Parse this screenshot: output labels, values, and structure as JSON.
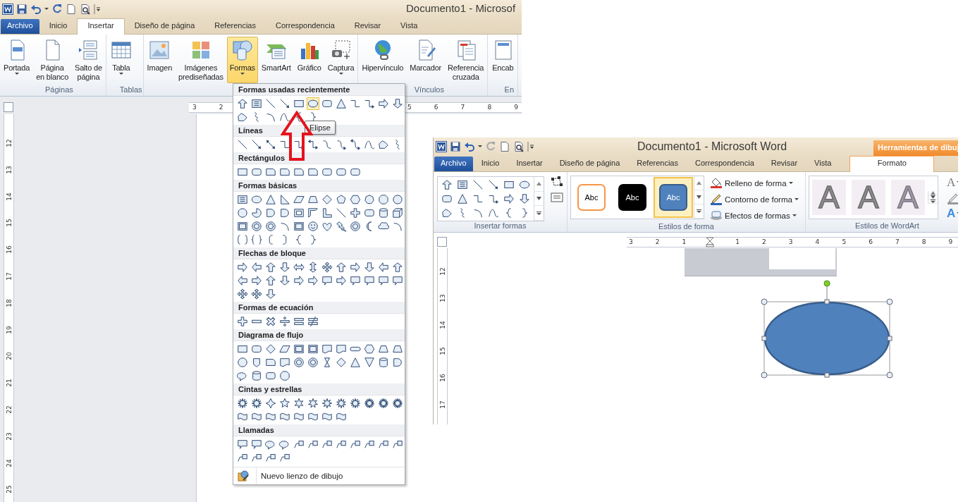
{
  "left_window": {
    "title": "Documento1 - Microsof",
    "tabs": [
      {
        "label": "Archivo",
        "kind": "file",
        "selected": false
      },
      {
        "label": "Inicio",
        "kind": "tab",
        "selected": false
      },
      {
        "label": "Insertar",
        "kind": "tab",
        "selected": true
      },
      {
        "label": "Diseño de página",
        "kind": "tab",
        "selected": false
      },
      {
        "label": "Referencias",
        "kind": "tab",
        "selected": false
      },
      {
        "label": "Correspondencia",
        "kind": "tab",
        "selected": false
      },
      {
        "label": "Revisar",
        "kind": "tab",
        "selected": false
      },
      {
        "label": "Vista",
        "kind": "tab",
        "selected": false
      }
    ],
    "groups": [
      {
        "label": "Páginas",
        "buttons": [
          {
            "kind": "cover-page",
            "lines": [
              "Portada"
            ],
            "dropdown": true,
            "selected": false
          },
          {
            "kind": "blank-page",
            "lines": [
              "Página",
              "en blanco"
            ],
            "dropdown": false,
            "selected": false
          },
          {
            "kind": "page-break",
            "lines": [
              "Salto de",
              "página"
            ],
            "dropdown": false,
            "selected": false
          }
        ]
      },
      {
        "label": "Tablas",
        "buttons": [
          {
            "kind": "table",
            "lines": [
              "Tabla"
            ],
            "dropdown": true,
            "selected": false
          }
        ]
      },
      {
        "buttons": [
          {
            "kind": "picture",
            "lines": [
              "Imagen"
            ],
            "dropdown": false,
            "selected": false
          },
          {
            "kind": "clip-art",
            "lines": [
              "Imágenes",
              "prediseñadas"
            ],
            "dropdown": false,
            "selected": false
          },
          {
            "kind": "shapes",
            "lines": [
              "Formas"
            ],
            "dropdown": true,
            "selected": true
          },
          {
            "kind": "smartart",
            "lines": [
              "SmartArt"
            ],
            "dropdown": false,
            "selected": false
          },
          {
            "kind": "chart",
            "lines": [
              "Gráfico"
            ],
            "dropdown": false,
            "selected": false
          },
          {
            "kind": "screenshot",
            "lines": [
              "Captura"
            ],
            "dropdown": true,
            "selected": false
          }
        ]
      },
      {
        "label": "Vínculos",
        "buttons": [
          {
            "kind": "hyperlink",
            "lines": [
              "Hipervínculo"
            ],
            "dropdown": false,
            "selected": false
          },
          {
            "kind": "bookmark",
            "lines": [
              "Marcador"
            ],
            "dropdown": false,
            "selected": false
          },
          {
            "kind": "cross-reference",
            "lines": [
              "Referencia",
              "cruzada"
            ],
            "dropdown": false,
            "selected": false
          }
        ]
      },
      {
        "label": "En",
        "buttons": [
          {
            "kind": "header",
            "lines": [
              "Encab"
            ],
            "dropdown": false,
            "selected": false
          }
        ]
      }
    ],
    "ruler_start": [
      "3",
      "2"
    ],
    "ruler_end": [
      "5",
      "6",
      "7",
      "8",
      "9"
    ],
    "ruler_vertical": [
      "12",
      "13",
      "14",
      "15",
      "16",
      "17",
      "18",
      "19",
      "20",
      "21",
      "22",
      "23",
      "24",
      "25"
    ],
    "shapes_menu": {
      "sections": [
        {
          "title": "Formas usadas recientemente",
          "items": [
            {
              "kind": "arrow-up",
              "selected": false
            },
            {
              "kind": "textbox",
              "selected": false
            },
            {
              "kind": "line",
              "selected": false
            },
            {
              "kind": "line-arrow",
              "selected": false
            },
            {
              "kind": "rect",
              "selected": false
            },
            {
              "kind": "ellipse",
              "selected": true
            },
            {
              "kind": "rounded",
              "selected": false
            },
            {
              "kind": "triangle",
              "selected": false
            },
            {
              "kind": "elbow",
              "selected": false
            },
            {
              "kind": "elbow-arrow",
              "selected": false
            },
            {
              "kind": "arrow-right",
              "selected": false
            },
            {
              "kind": "arrow-down",
              "selected": false
            },
            {
              "kind": "freeform",
              "selected": false
            },
            {
              "kind": "scribble",
              "selected": false
            },
            {
              "kind": "arc",
              "selected": false
            },
            {
              "kind": "curve",
              "selected": false
            },
            {
              "kind": "brace-left",
              "selected": false
            },
            {
              "kind": "brace-right",
              "selected": false
            }
          ]
        },
        {
          "title": "Líneas"
        },
        {
          "title": "Rectángulos"
        },
        {
          "title": "Formas básicas"
        },
        {
          "title": "Flechas de bloque"
        },
        {
          "title": "Formas de ecuación"
        },
        {
          "title": "Diagrama de flujo"
        },
        {
          "title": "Cintas y estrellas"
        },
        {
          "title": "Llamadas"
        }
      ],
      "footer": "Nuevo lienzo de dibujo",
      "tooltip": "Elipse"
    }
  },
  "right_window": {
    "title": "Documento1 - Microsoft Word",
    "context_label": "Herramientas de dibuj",
    "tabs": [
      {
        "label": "Archivo",
        "kind": "file",
        "selected": false
      },
      {
        "label": "Inicio",
        "kind": "tab",
        "selected": false
      },
      {
        "label": "Insertar",
        "kind": "tab",
        "selected": false
      },
      {
        "label": "Diseño de página",
        "kind": "tab",
        "selected": false
      },
      {
        "label": "Referencias",
        "kind": "tab",
        "selected": false
      },
      {
        "label": "Correspondencia",
        "kind": "tab",
        "selected": false
      },
      {
        "label": "Revisar",
        "kind": "tab",
        "selected": false
      },
      {
        "label": "Vista",
        "kind": "tab",
        "selected": false
      },
      {
        "label": "Formato",
        "kind": "context",
        "selected": true
      }
    ],
    "insert_shapes": {
      "label": "Insertar formas",
      "items": [
        {
          "kind": "arrow-up"
        },
        {
          "kind": "textbox"
        },
        {
          "kind": "line"
        },
        {
          "kind": "line-arrow"
        },
        {
          "kind": "rect"
        },
        {
          "kind": "ellipse"
        },
        {
          "kind": "rounded"
        },
        {
          "kind": "triangle"
        },
        {
          "kind": "elbow"
        },
        {
          "kind": "elbow-arrow"
        },
        {
          "kind": "arrow-right"
        },
        {
          "kind": "arrow-down"
        },
        {
          "kind": "freeform"
        },
        {
          "kind": "scribble"
        },
        {
          "kind": "arc"
        },
        {
          "kind": "curve"
        },
        {
          "kind": "brace-left"
        },
        {
          "kind": "brace-right"
        }
      ]
    },
    "shape_styles": {
      "label": "Estilos de forma",
      "styles": [
        {
          "label": "Abc",
          "kind": "outline",
          "color": "#f79646",
          "selected": false
        },
        {
          "label": "Abc",
          "kind": "filled",
          "color": "#000000",
          "selected": false
        },
        {
          "label": "Abc",
          "kind": "filled",
          "color": "#4f81bd",
          "selected": true
        }
      ],
      "commands": [
        {
          "kind": "fill",
          "label": "Relleno de forma"
        },
        {
          "kind": "outline",
          "label": "Contorno de forma"
        },
        {
          "kind": "effects",
          "label": "Efectos de formas"
        }
      ]
    },
    "wordart_styles": {
      "label": "Estilos de WordArt",
      "styles": [
        {
          "label": "A"
        },
        {
          "label": "A"
        },
        {
          "label": "A"
        }
      ],
      "tools": [
        {
          "kind": "text-fill",
          "label": "A"
        },
        {
          "kind": "text-outline"
        },
        {
          "kind": "text-effects",
          "label": "A"
        }
      ]
    },
    "ruler": [
      "3",
      "2",
      "1",
      "1",
      "2",
      "3",
      "4",
      "5",
      "6",
      "7",
      "8",
      "9"
    ],
    "ruler_vertical": [
      "12",
      "13",
      "14",
      "15",
      "16",
      "17"
    ]
  }
}
